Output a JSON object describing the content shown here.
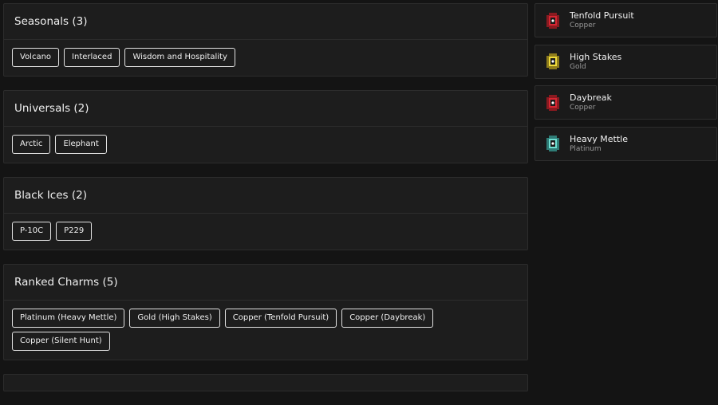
{
  "sections": [
    {
      "title": "Seasonals (3)",
      "items": [
        "Volcano",
        "Interlaced",
        "Wisdom and Hospitality"
      ]
    },
    {
      "title": "Universals (2)",
      "items": [
        "Arctic",
        "Elephant"
      ]
    },
    {
      "title": "Black Ices (2)",
      "items": [
        "P-10C",
        "P229"
      ]
    },
    {
      "title": "Ranked Charms (5)",
      "items": [
        "Platinum (Heavy Mettle)",
        "Gold (High Stakes)",
        "Copper (Tenfold Pursuit)",
        "Copper (Daybreak)",
        "Copper (Silent Hunt)"
      ]
    }
  ],
  "charms": [
    {
      "name": "Tenfold Pursuit",
      "tier": "Copper",
      "icon": "charm-copper-icon",
      "color": "#c8202a"
    },
    {
      "name": "High Stakes",
      "tier": "Gold",
      "icon": "charm-gold-icon",
      "color": "#e8d33a"
    },
    {
      "name": "Daybreak",
      "tier": "Copper",
      "icon": "charm-copper-icon",
      "color": "#c8202a"
    },
    {
      "name": "Heavy Mettle",
      "tier": "Platinum",
      "icon": "charm-platinum-icon",
      "color": "#5fd0c4"
    }
  ]
}
